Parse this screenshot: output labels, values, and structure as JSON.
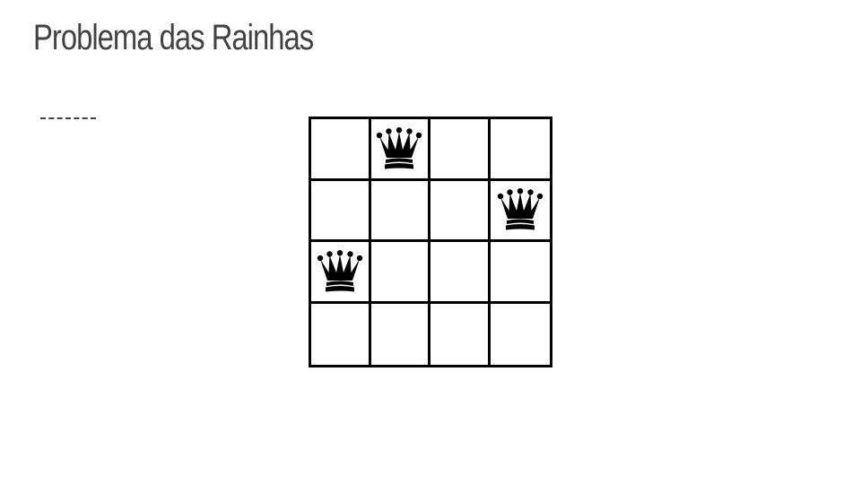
{
  "slide": {
    "title": "Problema das Rainhas"
  },
  "board": {
    "rows": 4,
    "cols": 4,
    "queens": [
      {
        "row": 0,
        "col": 1,
        "icon": "queen-icon"
      },
      {
        "row": 1,
        "col": 3,
        "icon": "queen-icon"
      },
      {
        "row": 2,
        "col": 0,
        "icon": "queen-icon"
      }
    ],
    "line_color": "#000000",
    "piece_color": "#000000"
  },
  "colors": {
    "title": "#424242",
    "background": "#ffffff"
  }
}
